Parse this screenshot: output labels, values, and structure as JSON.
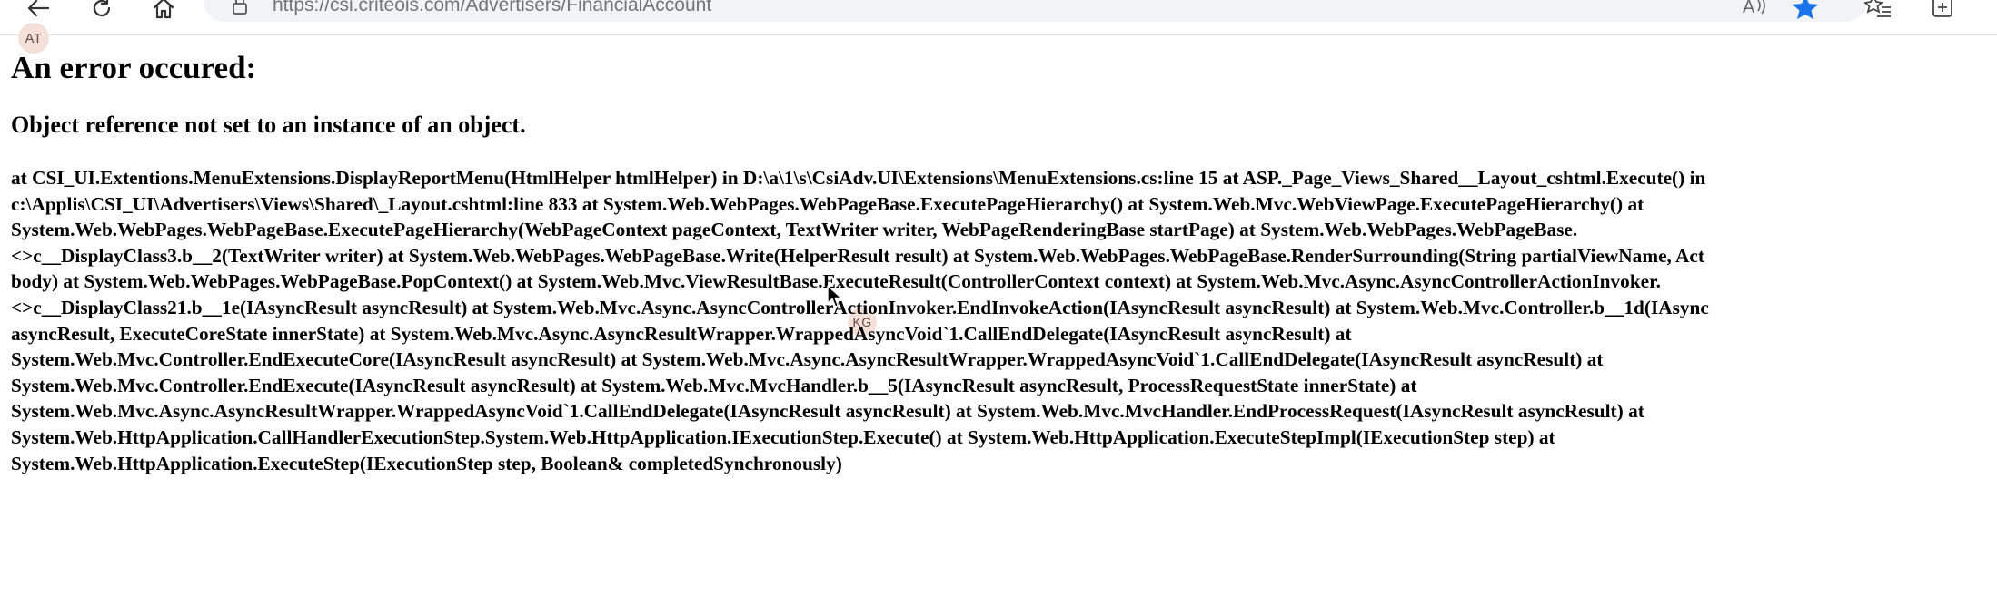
{
  "browser": {
    "url_host": "https://csi.criteois.com",
    "url_path": "/Advertisers/FinancialAccount",
    "icons": [
      "back-icon",
      "refresh-icon",
      "home-icon",
      "lock-icon",
      "read-aloud-icon",
      "favorite-star-icon",
      "favorites-list-icon",
      "collections-icon"
    ]
  },
  "avatars": {
    "top_left": "AT",
    "middle": "KG"
  },
  "page": {
    "title": "An error occured:",
    "message": "Object reference not set to an instance of an object.",
    "stacktrace_lines": [
      "at CSI_UI.Extentions.MenuExtensions.DisplayReportMenu(HtmlHelper htmlHelper) in D:\\a\\1\\s\\CsiAdv.UI\\Extensions\\MenuExtensions.cs:line 15 at ASP._Page_Views_Shared__Layout_cshtml.Execute() in",
      "c:\\Applis\\CSI_UI\\Advertisers\\Views\\Shared\\_Layout.cshtml:line 833 at System.Web.WebPages.WebPageBase.ExecutePageHierarchy() at System.Web.Mvc.WebViewPage.ExecutePageHierarchy() at",
      "System.Web.WebPages.WebPageBase.ExecutePageHierarchy(WebPageContext pageContext, TextWriter writer, WebPageRenderingBase startPage) at System.Web.WebPages.WebPageBase.",
      "<>c__DisplayClass3.b__2(TextWriter writer) at System.Web.WebPages.WebPageBase.Write(HelperResult result) at System.Web.WebPages.WebPageBase.RenderSurrounding(String partialViewName, Act",
      "body) at System.Web.WebPages.WebPageBase.PopContext() at System.Web.Mvc.ViewResultBase.ExecuteResult(ControllerContext context) at System.Web.Mvc.Async.AsyncControllerActionInvoker.",
      "<>c__DisplayClass21.b__1e(IAsyncResult asyncResult) at System.Web.Mvc.Async.AsyncControllerActionInvoker.EndInvokeAction(IAsyncResult asyncResult) at System.Web.Mvc.Controller.b__1d(IAsync",
      "asyncResult, ExecuteCoreState innerState) at System.Web.Mvc.Async.AsyncResultWrapper.WrappedAsyncVoid`1.CallEndDelegate(IAsyncResult asyncResult) at",
      "System.Web.Mvc.Controller.EndExecuteCore(IAsyncResult asyncResult) at System.Web.Mvc.Async.AsyncResultWrapper.WrappedAsyncVoid`1.CallEndDelegate(IAsyncResult asyncResult) at",
      "System.Web.Mvc.Controller.EndExecute(IAsyncResult asyncResult) at System.Web.Mvc.MvcHandler.b__5(IAsyncResult asyncResult, ProcessRequestState innerState) at",
      "System.Web.Mvc.Async.AsyncResultWrapper.WrappedAsyncVoid`1.CallEndDelegate(IAsyncResult asyncResult) at System.Web.Mvc.MvcHandler.EndProcessRequest(IAsyncResult asyncResult) at",
      "System.Web.HttpApplication.CallHandlerExecutionStep.System.Web.HttpApplication.IExecutionStep.Execute() at System.Web.HttpApplication.ExecuteStepImpl(IExecutionStep step) at",
      "System.Web.HttpApplication.ExecuteStep(IExecutionStep step, Boolean& completedSynchronously)"
    ]
  },
  "colors": {
    "accent_star": "#1a73e8",
    "avatar_bg": "#f3e0d9"
  }
}
